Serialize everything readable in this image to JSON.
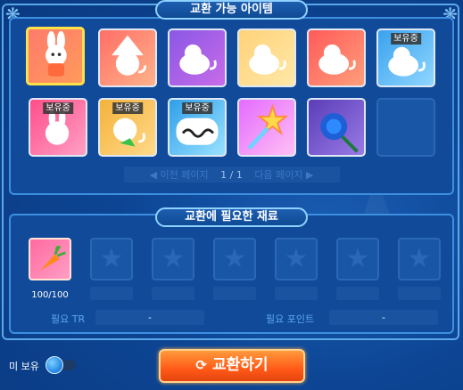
{
  "sections": {
    "items_title": "교환 가능 아이템",
    "materials_title": "교환에 필요한 재료"
  },
  "items": [
    {
      "name": "bunny-costume",
      "owned": false,
      "selected": true
    },
    {
      "name": "cat-wizard-hat",
      "owned": false
    },
    {
      "name": "cat-purple-frame",
      "owned": false
    },
    {
      "name": "cat-gold-frame",
      "owned": false
    },
    {
      "name": "cat-red-frame",
      "owned": false
    },
    {
      "name": "cat-blue-frame",
      "owned": true
    },
    {
      "name": "bunny-pink-frame",
      "owned": true
    },
    {
      "name": "cat-green-frame",
      "owned": true
    },
    {
      "name": "cat-balloon",
      "owned": true
    },
    {
      "name": "star-wand",
      "owned": false
    },
    {
      "name": "blue-rose",
      "owned": false
    },
    {
      "name": "empty",
      "owned": false
    }
  ],
  "owned_badge": "보유중",
  "pager": {
    "prev": "◀ 이전 페이지",
    "page": "1 / 1",
    "next": "다음 페이지 ▶"
  },
  "materials": [
    {
      "icon": "carrot-icon",
      "count": "100/100"
    }
  ],
  "requirements": {
    "tr_label": "필요 TR",
    "tr_value": "-",
    "points_label": "필요 포인트",
    "points_value": "-"
  },
  "toggle": {
    "label": "미 보유",
    "on": true
  },
  "exchange_button": {
    "icon": "⟳",
    "label": "교환하기"
  },
  "colors": {
    "accent": "#ff5a17",
    "frame": "#3d8fe0",
    "selected": "#ffe14a"
  }
}
